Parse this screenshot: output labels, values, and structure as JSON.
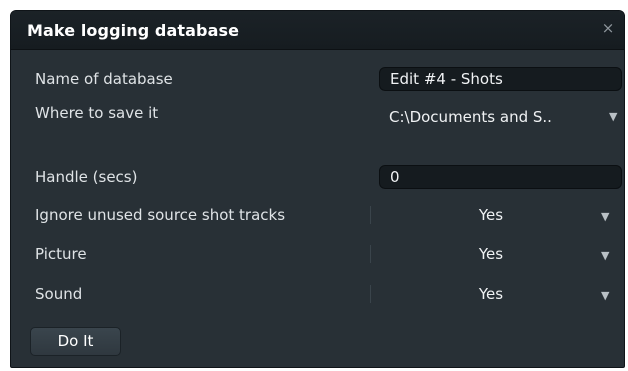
{
  "dialog": {
    "title": "Make logging database",
    "close_glyph": "×"
  },
  "fields": {
    "name_label": "Name of database",
    "name_value": "Edit #4 - Shots",
    "where_label": "Where to save it",
    "where_value": "C:\\Documents and S..",
    "handle_label": "Handle (secs)",
    "handle_value": "0"
  },
  "options": [
    {
      "label": "Ignore unused source shot tracks",
      "value": "Yes"
    },
    {
      "label": "Picture",
      "value": "Yes"
    },
    {
      "label": "Sound",
      "value": "Yes"
    }
  ],
  "actions": {
    "do_it_label": "Do It"
  },
  "icons": {
    "dropdown": "chevron-down-icon",
    "close": "close-icon"
  },
  "colors": {
    "dialog_bg": "#283036",
    "titlebar_bg": "#181f24",
    "field_bg": "#151b1f",
    "text": "#dfe3e6"
  }
}
